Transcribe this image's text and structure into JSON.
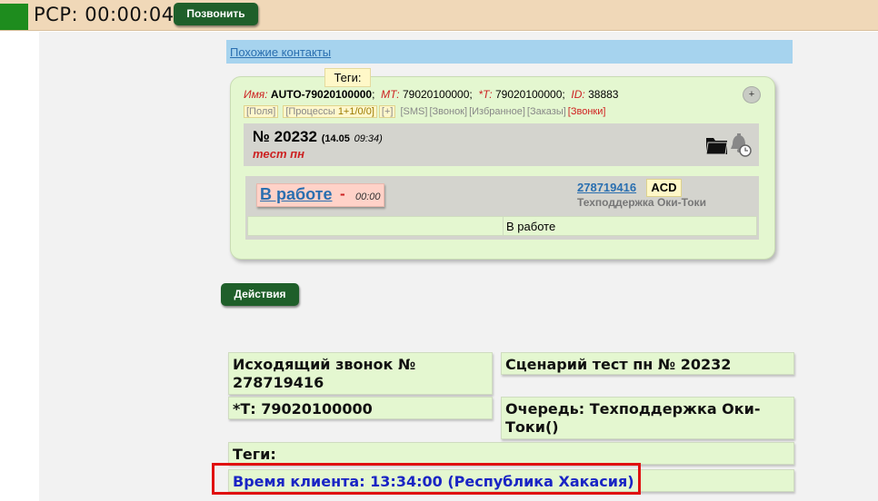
{
  "topbar": {
    "timer": "РСР: 00:00:04",
    "call_button": "Позвонить",
    "status_color": "#1e8c1e"
  },
  "similar_contacts": {
    "link": "Похожие контакты"
  },
  "tags_tooltip": "Теги:",
  "contact": {
    "name_label": "Имя:",
    "name_value": "AUTO-79020100000",
    "mt_label": "МТ:",
    "mt_value": "79020100000",
    "t_label": "*Т:",
    "t_value": "79020100000",
    "id_label": "ID:",
    "id_value": "38883",
    "plus": "+",
    "links": {
      "fields": "[Поля]",
      "processes_prefix": "[Процессы",
      "processes_count": "1+1/0/0]",
      "add": "[+]",
      "sms": "[SMS]",
      "call": "[Звонок]",
      "favorites": "[Избранное]",
      "orders": "[Заказы]",
      "calls": "[Звонки]"
    }
  },
  "order": {
    "number": "№ 20232",
    "date": "(14.05",
    "time": "09:34)",
    "subtitle": "тест пн",
    "icons": [
      "folder-icon",
      "bell-clock-icon"
    ]
  },
  "status": {
    "label": "В работе",
    "dash": "-",
    "elapsed": "00:00",
    "call_id": "278719416",
    "badge": "ACD",
    "queue": "Техподдержка Оки-Токи",
    "row_text": "В работе"
  },
  "actions_button": "Действия",
  "details": {
    "outgoing_call": "Исходящий звонок № 278719416",
    "scenario": "Сценарий тест пн № 20232",
    "phone": "*Т: 79020100000",
    "queue": "Очередь: Техподдержка Оки-Токи()",
    "tags": "Теги:",
    "client_time": "Время клиента: 13:34:00 (Республика Хакасия)"
  },
  "colors": {
    "accent_green": "#1f5f2a",
    "card_bg": "#e4f7d0",
    "highlight": "#e01010",
    "link_blue": "#2a6fb0"
  }
}
